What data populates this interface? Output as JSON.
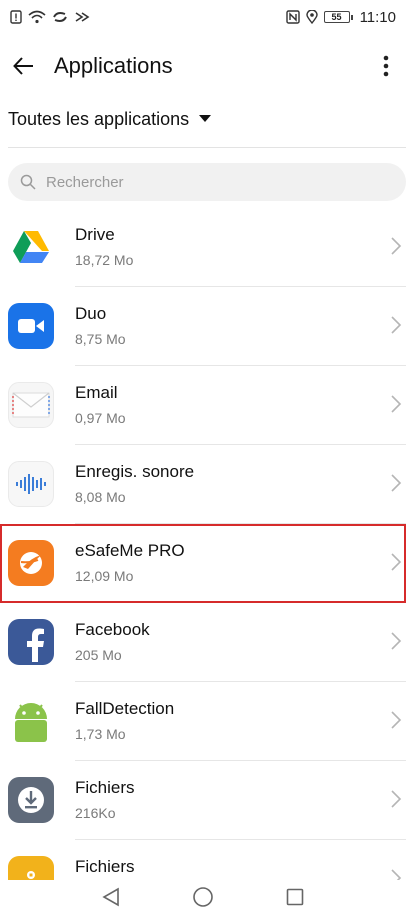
{
  "status_bar": {
    "battery": "55",
    "time": "11:10"
  },
  "header": {
    "title": "Applications"
  },
  "filter": {
    "label": "Toutes les applications"
  },
  "search": {
    "placeholder": "Rechercher"
  },
  "apps": [
    {
      "name": "Drive",
      "size": "18,72 Mo",
      "icon": "google-drive-icon"
    },
    {
      "name": "Duo",
      "size": "8,75 Mo",
      "icon": "duo-video-icon"
    },
    {
      "name": "Email",
      "size": "0,97 Mo",
      "icon": "email-envelope-icon"
    },
    {
      "name": "Enregis. sonore",
      "size": "8,08 Mo",
      "icon": "sound-recorder-icon"
    },
    {
      "name": "eSafeMe PRO",
      "size": "12,09 Mo",
      "icon": "esafeme-icon",
      "highlighted": true
    },
    {
      "name": "Facebook",
      "size": "205 Mo",
      "icon": "facebook-icon"
    },
    {
      "name": "FallDetection",
      "size": "1,73 Mo",
      "icon": "android-icon"
    },
    {
      "name": "Fichiers",
      "size": "216Ko",
      "icon": "download-files-icon"
    },
    {
      "name": "Fichiers",
      "size": "",
      "icon": "files-folder-icon"
    }
  ],
  "colors": {
    "highlight_border": "#d62b2b",
    "duo_blue": "#1a73e8",
    "esafeme_orange": "#f47c20",
    "facebook_blue": "#3b5998",
    "android_green": "#8bc34a"
  }
}
